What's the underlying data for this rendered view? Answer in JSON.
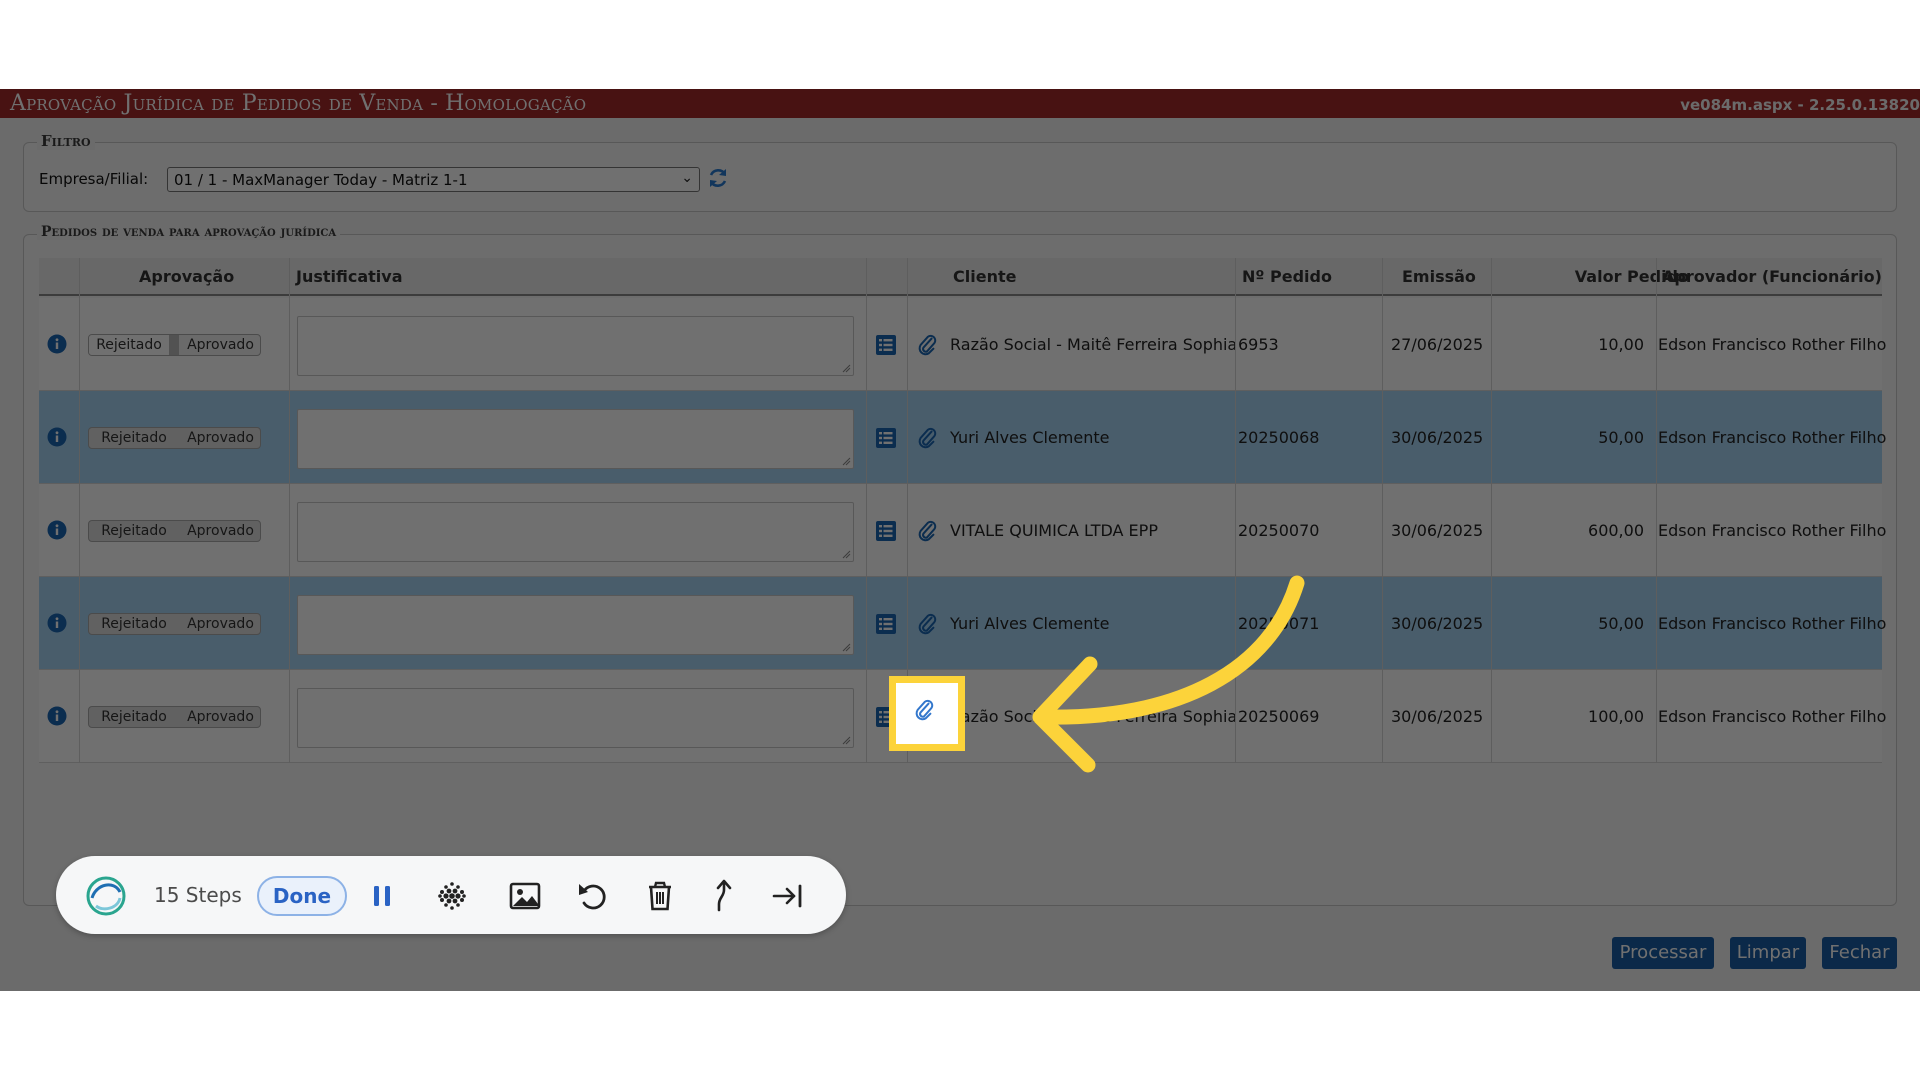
{
  "app": {
    "title": "Aprovação Jurídica de Pedidos de Venda  - Homologação",
    "version": "ve084m.aspx - 2.25.0.13820"
  },
  "filter": {
    "legend": "Filtro",
    "label": "Empresa/Filial:",
    "selected": "01 / 1 - MaxManager Today - Matriz 1-1"
  },
  "orders": {
    "legend": "Pedidos de venda para aprovação jurídica",
    "columns": {
      "aprovacao": "Aprovação",
      "justificativa": "Justificativa",
      "cliente": "Cliente",
      "pedido": "Nº Pedido",
      "emissao": "Emissão",
      "valor": "Valor Pedido",
      "aprovador": "Aprovador (Funcionário)"
    },
    "toggle": {
      "rejected": "Rejeitado",
      "approved": "Aprovado"
    },
    "rows": [
      {
        "cliente": "Razão Social - Maitê Ferreira Sophia",
        "pedido": "6953",
        "emissao": "27/06/2025",
        "valor": "10,00",
        "aprovador": "Edson Francisco Rother Filho"
      },
      {
        "cliente": "Yuri Alves Clemente",
        "pedido": "20250068",
        "emissao": "30/06/2025",
        "valor": "50,00",
        "aprovador": "Edson Francisco Rother Filho"
      },
      {
        "cliente": "VITALE QUIMICA LTDA EPP",
        "pedido": "20250070",
        "emissao": "30/06/2025",
        "valor": "600,00",
        "aprovador": "Edson Francisco Rother Filho"
      },
      {
        "cliente": "Yuri Alves Clemente",
        "pedido": "20250071",
        "emissao": "30/06/2025",
        "valor": "50,00",
        "aprovador": "Edson Francisco Rother Filho"
      },
      {
        "cliente": "Razão Social - Maitê Ferreira Sophia",
        "pedido": "20250069",
        "emissao": "30/06/2025",
        "valor": "100,00",
        "aprovador": "Edson Francisco Rother Filho"
      }
    ]
  },
  "buttons": {
    "processar": "Processar",
    "limpar": "Limpar",
    "fechar": "Fechar"
  },
  "recorder": {
    "steps": "15 Steps",
    "done": "Done",
    "tools": [
      "pause-icon",
      "blur-icon",
      "image-icon",
      "undo-icon",
      "trash-icon",
      "move-up-icon",
      "skip-end-icon"
    ]
  },
  "colors": {
    "title_bar": "#a52a2a",
    "row_alt": "#a7d3f4",
    "button": "#1b5fa6",
    "highlight": "#fcd33a"
  }
}
